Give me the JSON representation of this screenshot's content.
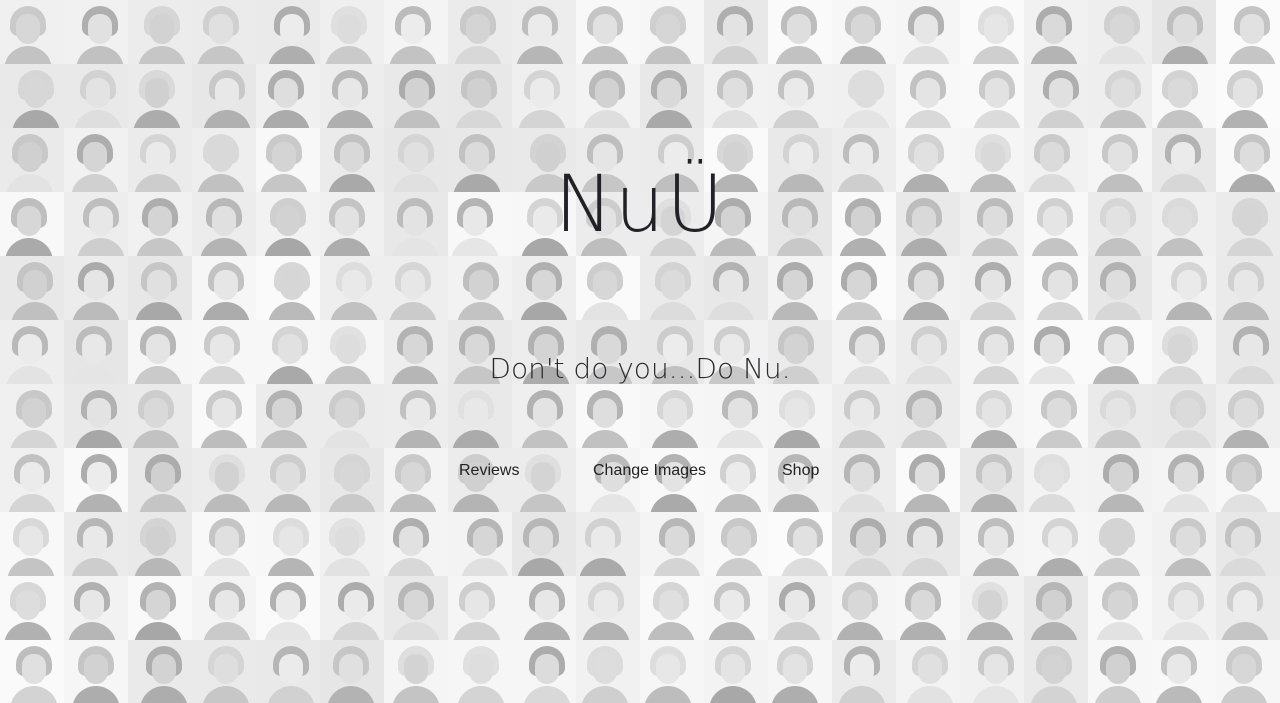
{
  "brand": {
    "logo_text": "NuÜ",
    "tagline": "Don't do you...Do Nu."
  },
  "nav": {
    "items": [
      {
        "label": "Reviews"
      },
      {
        "label": "Change Images"
      },
      {
        "label": "Shop"
      }
    ]
  },
  "background": {
    "description_icon": "portrait-mosaic-icon",
    "tone": "grayscale"
  },
  "colors": {
    "text": "#222226",
    "page": "#efefef"
  }
}
